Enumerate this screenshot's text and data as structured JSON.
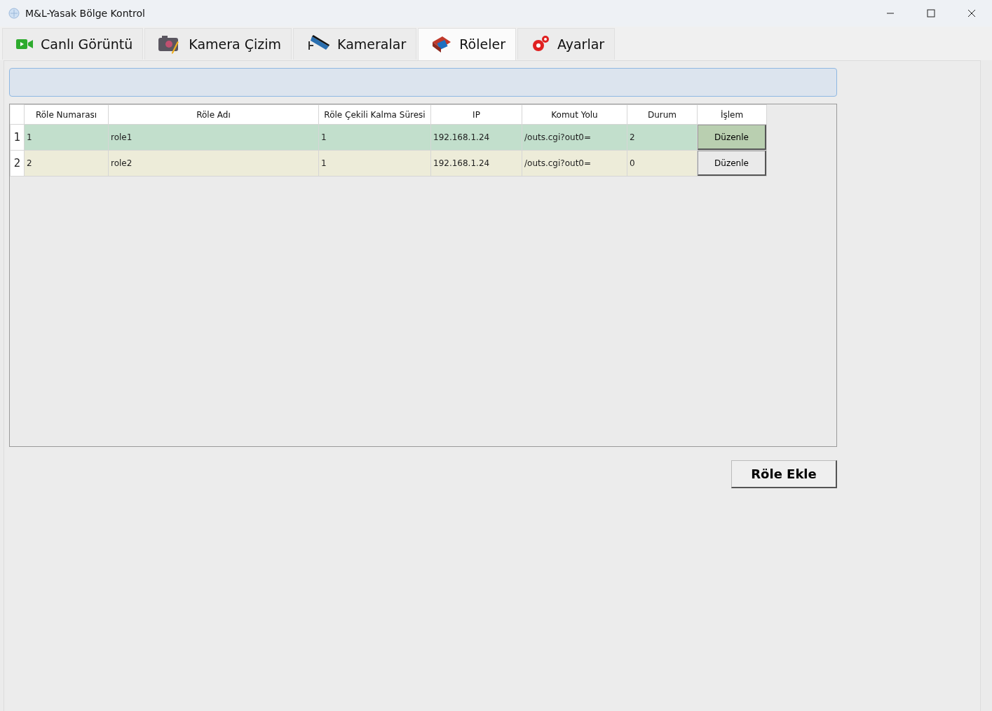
{
  "window": {
    "title": "M&L-Yasak Bölge Kontrol"
  },
  "tabs": [
    {
      "label": "Canlı Görüntü",
      "kind": "video",
      "selected": false
    },
    {
      "label": "Kamera Çizim",
      "kind": "camera",
      "selected": false
    },
    {
      "label": "Kameralar",
      "kind": "cctv",
      "selected": false
    },
    {
      "label": "Röleler",
      "kind": "relay",
      "selected": true
    },
    {
      "label": "Ayarlar",
      "kind": "gears",
      "selected": false
    }
  ],
  "table": {
    "columns": [
      "Röle Numarası",
      "Röle Adı",
      "Röle Çekili Kalma Süresi",
      "IP",
      "Komut Yolu",
      "Durum",
      "İşlem"
    ],
    "rows": [
      {
        "header": "1",
        "cells": [
          "1",
          "role1",
          "1",
          "192.168.1.24",
          "/outs.cgi?out0=",
          "2"
        ],
        "action": "Düzenle",
        "color": "#c2dfcc",
        "selected": true
      },
      {
        "header": "2",
        "cells": [
          "2",
          "role2",
          "1",
          "192.168.1.24",
          "/outs.cgi?out0=",
          "0"
        ],
        "action": "Düzenle",
        "color": "#edecd9",
        "selected": false
      }
    ]
  },
  "add_button": "Röle Ekle"
}
